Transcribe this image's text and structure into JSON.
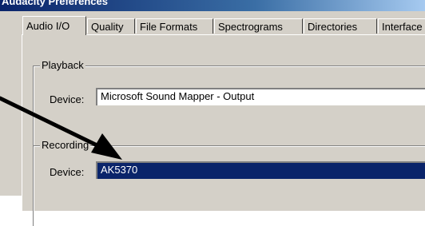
{
  "window": {
    "title": "Audacity Preferences"
  },
  "tabs": [
    {
      "label": "Audio I/O",
      "active": true
    },
    {
      "label": "Quality",
      "active": false
    },
    {
      "label": "File Formats",
      "active": false
    },
    {
      "label": "Spectrograms",
      "active": false
    },
    {
      "label": "Directories",
      "active": false
    },
    {
      "label": "Interface",
      "active": false
    }
  ],
  "playback": {
    "group_title": "Playback",
    "device_label": "Device:",
    "device_value": "Microsoft Sound Mapper - Output"
  },
  "recording": {
    "group_title": "Recording",
    "device_label": "Device:",
    "device_value": "AK5370",
    "selected": true
  },
  "colors": {
    "dialog_face": "#d4d0c8",
    "selection": "#0a246a",
    "selection_text": "#ffffff"
  },
  "annotation": {
    "icon": "callout-arrow-icon"
  }
}
